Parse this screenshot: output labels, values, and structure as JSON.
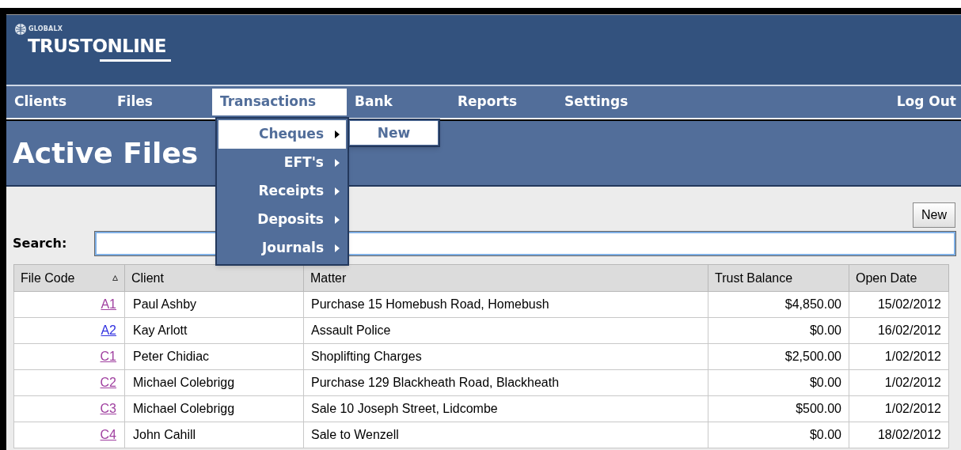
{
  "logo": {
    "brand": "GLOBALX",
    "product": "TRUSTONLINE"
  },
  "nav": [
    {
      "label": "Clients",
      "selected": false
    },
    {
      "label": "Files",
      "selected": false
    },
    {
      "label": "Transactions",
      "selected": true
    },
    {
      "label": "Bank",
      "selected": false
    },
    {
      "label": "Reports",
      "selected": false
    },
    {
      "label": "Settings",
      "selected": false
    }
  ],
  "logout": "Log Out",
  "dropdown": [
    {
      "label": "Cheques",
      "selected": true
    },
    {
      "label": "EFT's",
      "selected": false
    },
    {
      "label": "Receipts",
      "selected": false
    },
    {
      "label": "Deposits",
      "selected": false
    },
    {
      "label": "Journals",
      "selected": false
    }
  ],
  "submenu": [
    "New"
  ],
  "page_title": "Active Files",
  "new_button": "New",
  "search": {
    "label": "Search:"
  },
  "table": {
    "columns": [
      {
        "label": "File Code",
        "sort": "▵"
      },
      {
        "label": "Client"
      },
      {
        "label": "Matter"
      },
      {
        "label": "Trust Balance"
      },
      {
        "label": "Open Date"
      }
    ],
    "rows": [
      {
        "code": "A1",
        "visited": true,
        "client": "Paul Ashby",
        "matter": "Purchase 15 Homebush Road, Homebush",
        "balance": "$4,850.00",
        "date": "15/02/2012"
      },
      {
        "code": "A2",
        "visited": false,
        "client": "Kay Arlott",
        "matter": "Assault Police",
        "balance": "$0.00",
        "date": "16/02/2012"
      },
      {
        "code": "C1",
        "visited": true,
        "client": "Peter Chidiac",
        "matter": "Shoplifting Charges",
        "balance": "$2,500.00",
        "date": "1/02/2012"
      },
      {
        "code": "C2",
        "visited": true,
        "client": "Michael Colebrigg",
        "matter": "Purchase 129 Blackheath Road, Blackheath",
        "balance": "$0.00",
        "date": "1/02/2012"
      },
      {
        "code": "C3",
        "visited": true,
        "client": "Michael Colebrigg",
        "matter": "Sale 10 Joseph Street, Lidcombe",
        "balance": "$500.00",
        "date": "1/02/2012"
      },
      {
        "code": "C4",
        "visited": true,
        "client": "John Cahill",
        "matter": "Sale to Wenzell",
        "balance": "$0.00",
        "date": "18/02/2012"
      }
    ]
  }
}
